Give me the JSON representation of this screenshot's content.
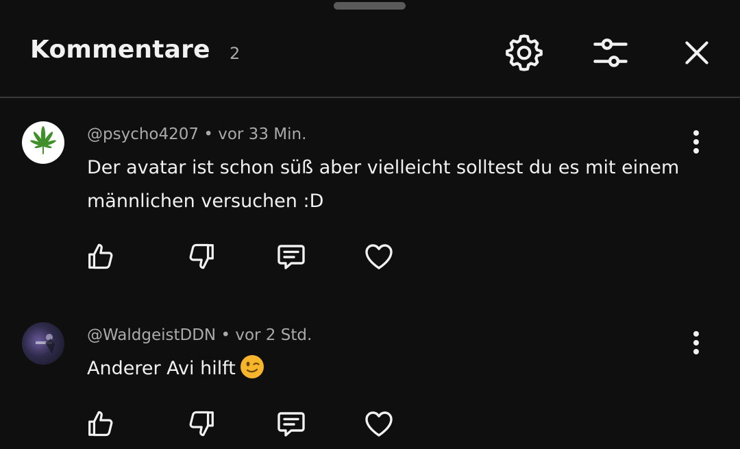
{
  "header": {
    "title": "Kommentare",
    "count": "2",
    "icons": [
      "gear-icon",
      "sliders-icon",
      "close-icon"
    ]
  },
  "comments": [
    {
      "author": "@psycho4207",
      "time": "vor 33 Min.",
      "text": "Der avatar ist schon süß aber vielleicht solltest du es mit einem männlichen versuchen :D",
      "avatar": "cannabis-leaf"
    },
    {
      "author": "@WaldgeistDDN",
      "time": "vor 2 Std.",
      "text": "Anderer Avi hilft",
      "emoji": "winking-face",
      "avatar": "dark-purple-photo"
    }
  ],
  "actions": [
    "thumbs-up-icon",
    "thumbs-down-icon",
    "reply-icon",
    "heart-icon"
  ],
  "colors": {
    "background": "#0f0f0f",
    "text": "#f1f1f1",
    "secondary": "#aaaaaa",
    "divider": "#3a3a3a"
  }
}
